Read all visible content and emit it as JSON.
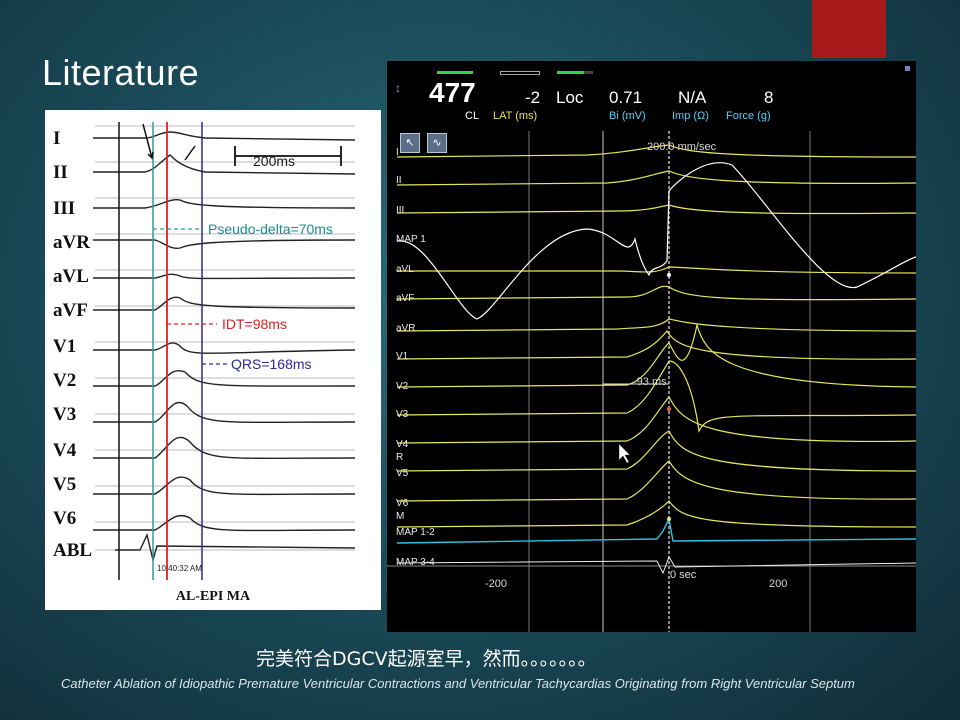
{
  "slide": {
    "title": "Literature",
    "note": "完美符合DGCV起源室早，然而。。。。。。。",
    "reference": "Catheter Ablation of Idiopathic Premature Ventricular Contractions and Ventricular Tachycardias Originating from Right Ventricular Septum",
    "accent_color": "#a5191a"
  },
  "ecg_figure": {
    "leads": [
      "I",
      "II",
      "III",
      "aVR",
      "aVL",
      "aVF",
      "V1",
      "V2",
      "V3",
      "V4",
      "V5",
      "V6",
      "ABL"
    ],
    "scale_label": "200ms",
    "annotations": {
      "pseudo_delta": "Pseudo-delta=70ms",
      "idt": "IDT=98ms",
      "qrs": "QRS=168ms",
      "timestamp": "10:40:32 AM"
    },
    "caption": "AL-EPI MA"
  },
  "ep_system": {
    "header": {
      "cl_value": "477",
      "cl_label": "CL",
      "lat_value": "-2",
      "lat_label": "LAT (ms)",
      "loc_label": "Loc",
      "bi_value": "0.71",
      "bi_label": "Bi (mV)",
      "imp_value": "N/A",
      "imp_label": "Imp (Ω)",
      "force_value": "8",
      "force_label": "Force (g)"
    },
    "sweep_label": "200.0 mm/sec",
    "channels": [
      "I",
      "II",
      "III",
      "MAP 1",
      "aVL",
      "aVF",
      "aVR",
      "V1",
      "V2",
      "V3",
      "V4",
      "R",
      "V5",
      "V6",
      "M",
      "MAP 1-2",
      "MAP 3-4"
    ],
    "measure_label": "-93 ms",
    "axis": {
      "left": "-200",
      "zero": "0 sec",
      "right": "200"
    },
    "tools": [
      "cursor-tool-icon",
      "waveform-add-icon"
    ],
    "colors": {
      "surface": "#e8e65a",
      "map": "#ffffff",
      "map12": "#2ec4e0"
    }
  }
}
